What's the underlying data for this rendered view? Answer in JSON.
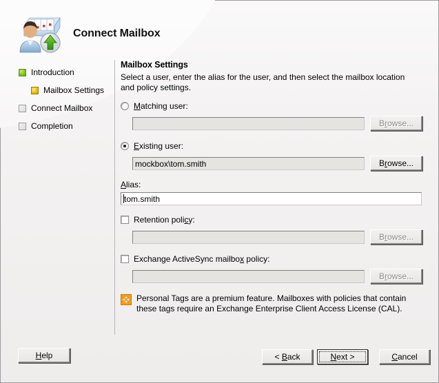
{
  "window": {
    "title": "Connect Mailbox",
    "icon": "connect-mailbox-icon"
  },
  "sidebar": {
    "items": [
      {
        "label": "Introduction",
        "state": "green",
        "indent": false
      },
      {
        "label": "Mailbox Settings",
        "state": "yellow",
        "indent": true
      },
      {
        "label": "Connect Mailbox",
        "state": "gray",
        "indent": false
      },
      {
        "label": "Completion",
        "state": "gray",
        "indent": false
      }
    ]
  },
  "main": {
    "title": "Mailbox Settings",
    "description": "Select a user, enter the alias for the user, and then select the mailbox location and policy settings.",
    "matching_user": {
      "label_pre": "",
      "label_accel": "M",
      "label_post": "atching user:",
      "selected": false,
      "value": "",
      "browse_label_pre": "B",
      "browse_label_accel": "r",
      "browse_label_post": "owse...",
      "enabled": false
    },
    "existing_user": {
      "label_pre": "",
      "label_accel": "E",
      "label_post": "xisting user:",
      "selected": true,
      "value": "mockbox\\tom.smith",
      "browse_label_pre": "B",
      "browse_label_accel": "r",
      "browse_label_post": "owse...",
      "enabled": true
    },
    "alias": {
      "label_accel": "A",
      "label_post": "lias:",
      "value": "tom.smith"
    },
    "retention_policy": {
      "label_pre": "Retention poli",
      "label_accel": "c",
      "label_post": "y:",
      "checked": false,
      "value": "",
      "browse_label_pre": "B",
      "browse_label_accel": "r",
      "browse_label_post": "owse...",
      "enabled": false
    },
    "activesync_policy": {
      "label_pre": "Exchange ActiveSync mailbo",
      "label_accel": "x",
      "label_post": " policy:",
      "checked": false,
      "value": "",
      "browse_label_pre": "B",
      "browse_label_accel": "r",
      "browse_label_post": "owse...",
      "enabled": false
    },
    "note": {
      "icon": "premium-feature-icon",
      "text": "Personal Tags are a premium feature. Mailboxes with policies that contain these tags require an Exchange Enterprise Client Access License (CAL).",
      "icon_color": "#f59b1c"
    }
  },
  "footer": {
    "help": {
      "pre": "",
      "accel": "H",
      "post": "elp"
    },
    "back": {
      "pre": "< ",
      "accel": "B",
      "post": "ack"
    },
    "next": {
      "pre": "",
      "accel": "N",
      "post": "ext >",
      "is_default": true
    },
    "cancel": {
      "pre": "",
      "accel": "C",
      "post": "ancel"
    }
  },
  "colors": {
    "dialog_background": "#f0eeee",
    "accent_green": "#88d226",
    "accent_yellow": "#f5c518",
    "warning_orange": "#f59b1c",
    "separator": "#b6b6bc"
  }
}
